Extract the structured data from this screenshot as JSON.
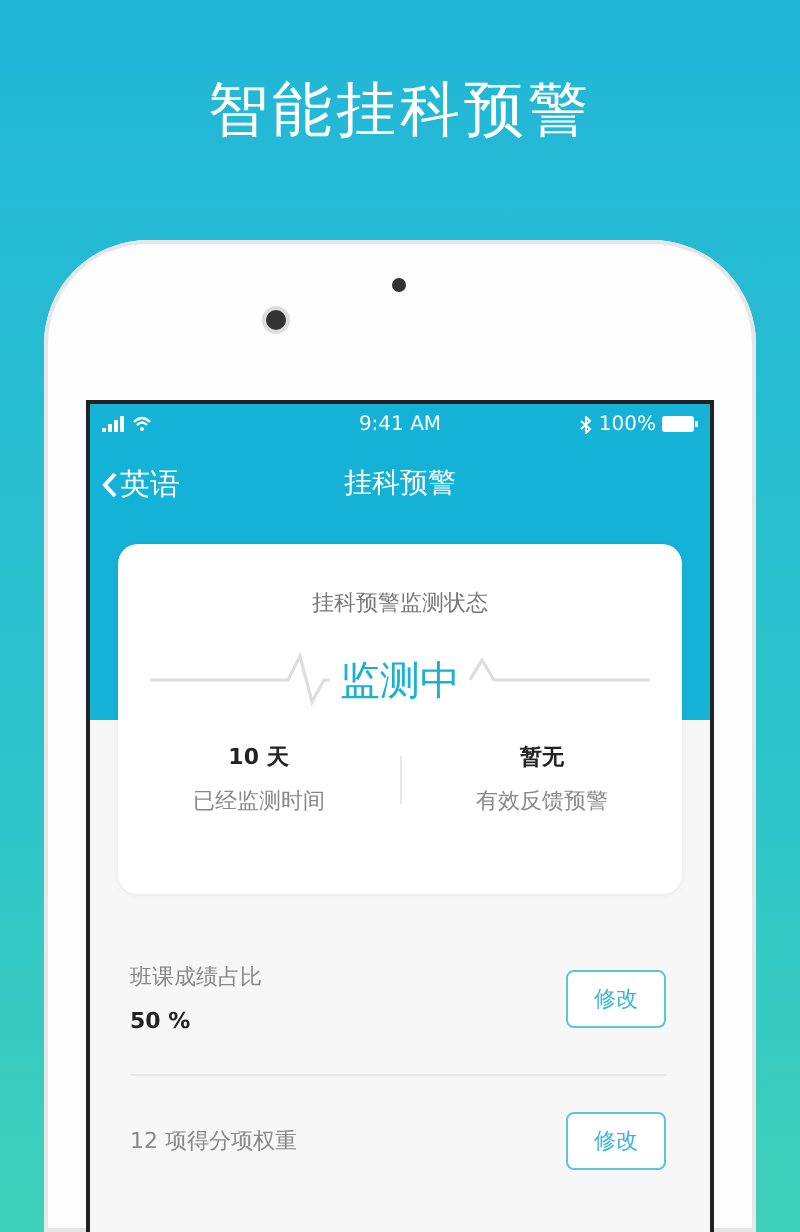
{
  "headline": "智能挂科预警",
  "status_bar": {
    "time": "9:41 AM",
    "battery": "100%"
  },
  "nav": {
    "back": "英语",
    "title": "挂科预警"
  },
  "monitor_card": {
    "caption": "挂科预警监测状态",
    "status": "监测中",
    "stats": [
      {
        "value": "10 天",
        "label": "已经监测时间"
      },
      {
        "value": "暂无",
        "label": "有效反馈预警"
      }
    ]
  },
  "settings": [
    {
      "label": "班课成绩占比",
      "value": "50 %",
      "button": "修改"
    },
    {
      "label": "12 项得分项权重",
      "button": "修改"
    }
  ]
}
